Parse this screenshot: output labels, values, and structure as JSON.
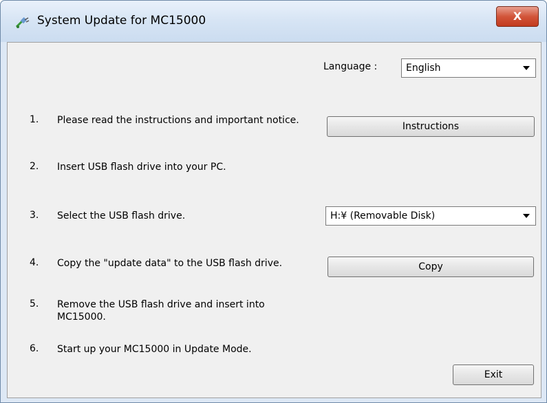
{
  "window": {
    "title": "System Update for MC15000",
    "close_label": "X"
  },
  "language": {
    "label": "Language :",
    "selected": "English"
  },
  "steps": [
    {
      "num": "1.",
      "text": "Please read the instructions and important notice."
    },
    {
      "num": "2.",
      "text": "Insert USB flash drive into your PC."
    },
    {
      "num": "3.",
      "text": "Select the USB flash drive."
    },
    {
      "num": "4.",
      "text": "Copy the \"update data\" to the USB flash drive."
    },
    {
      "num": "5.",
      "text": "Remove the USB flash drive and insert into MC15000."
    },
    {
      "num": "6.",
      "text": "Start up your MC15000 in Update Mode."
    }
  ],
  "buttons": {
    "instructions": "Instructions",
    "copy": "Copy",
    "exit": "Exit"
  },
  "drive_select": {
    "selected": "H:¥ (Removable Disk)"
  },
  "icons": {
    "app": "usb-plug-icon",
    "close": "close-icon",
    "dropdown": "chevron-down-icon"
  },
  "colors": {
    "frame": "#dde8f5",
    "client": "#f0f0f0",
    "close_button": "#d2553a"
  }
}
